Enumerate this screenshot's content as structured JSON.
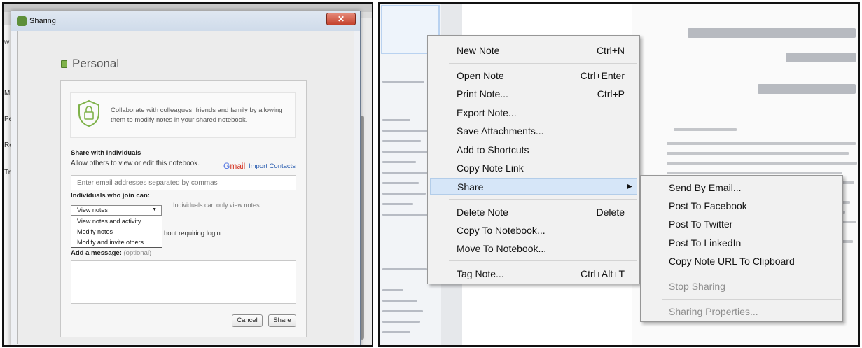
{
  "dialog": {
    "title": "Sharing",
    "close_glyph": "✕",
    "notebook_title": "Personal",
    "banner_text": "Collaborate with colleagues, friends and family by allowing them to modify notes in your shared notebook.",
    "share_heading": "Share with individuals",
    "share_sub": "Allow others to view or edit this notebook.",
    "gmail_g": "G",
    "gmail_rest": "mail",
    "import_contacts": "Import Contacts",
    "email_placeholder": "Enter email addresses separated by commas",
    "join_heading": "Individuals who join can:",
    "permission_selected": "View notes",
    "permission_help": "Individuals can only view notes.",
    "permission_options": [
      "View notes and activity",
      "Modify notes",
      "Modify and invite others"
    ],
    "login_text": "hout requiring login",
    "message_label": "Add a message:",
    "message_optional": "(optional)",
    "cancel": "Cancel",
    "share": "Share"
  },
  "background_sidebar": [
    "w",
    "M",
    "Pe",
    "Re",
    "Tr"
  ],
  "context_menu": {
    "items": [
      {
        "label": "New Note",
        "shortcut": "Ctrl+N"
      },
      {
        "label": "Open Note",
        "shortcut": "Ctrl+Enter"
      },
      {
        "label": "Print Note...",
        "shortcut": "Ctrl+P"
      },
      {
        "label": "Export Note...",
        "shortcut": ""
      },
      {
        "label": "Save Attachments...",
        "shortcut": ""
      },
      {
        "label": "Add to Shortcuts",
        "shortcut": ""
      },
      {
        "label": "Copy Note Link",
        "shortcut": ""
      },
      {
        "label": "Share",
        "shortcut": ""
      },
      {
        "label": "Delete Note",
        "shortcut": "Delete"
      },
      {
        "label": "Copy To Notebook...",
        "shortcut": ""
      },
      {
        "label": "Move To Notebook...",
        "shortcut": ""
      },
      {
        "label": "Tag Note...",
        "shortcut": "Ctrl+Alt+T"
      }
    ]
  },
  "share_submenu": {
    "items": [
      {
        "label": "Send By Email..."
      },
      {
        "label": "Post To Facebook"
      },
      {
        "label": "Post To Twitter"
      },
      {
        "label": "Post To LinkedIn"
      },
      {
        "label": "Copy Note URL To Clipboard"
      },
      {
        "label": "Stop Sharing"
      },
      {
        "label": "Sharing Properties..."
      }
    ]
  }
}
